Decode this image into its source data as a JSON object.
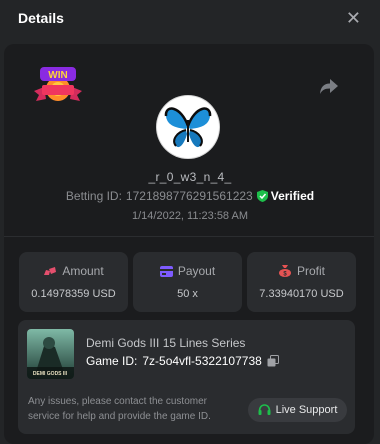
{
  "header": {
    "title": "Details"
  },
  "badge": {
    "text": "WIN"
  },
  "user": {
    "username": "_r_0_w3_n_4_",
    "betting_id_label": "Betting ID:",
    "betting_id": "1721898776291561223",
    "verified_label": "Verified",
    "date": "1/14/2022, 11:23:58 AM"
  },
  "stats": {
    "amount": {
      "label": "Amount",
      "value": "0.14978359 USD"
    },
    "payout": {
      "label": "Payout",
      "value": "50 x"
    },
    "profit": {
      "label": "Profit",
      "value": "7.33940170 USD"
    }
  },
  "game": {
    "name": "Demi Gods III 15 Lines Series",
    "id_label": "Game ID:",
    "id": "7z-5o4vfl-5322107738",
    "thumb_text": "DEMI GODS III",
    "support_text": "Any issues, please contact the customer service for help and provide the game ID.",
    "live_support_label": "Live Support"
  },
  "colors": {
    "verified": "#1dbf4b",
    "amount_icon": "#e54f6d",
    "payout_icon": "#7e5bff",
    "profit_icon": "#e55353",
    "support_icon": "#1dbf4b"
  }
}
